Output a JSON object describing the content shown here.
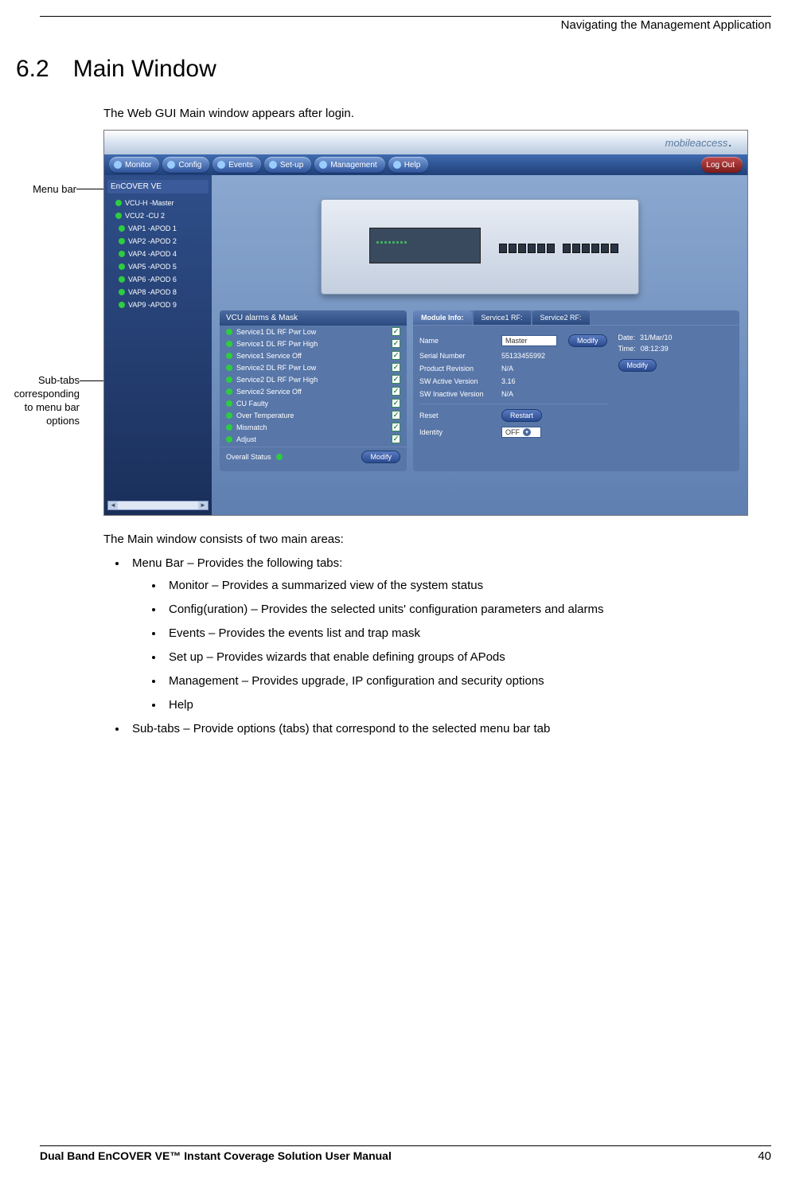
{
  "header": {
    "right": "Navigating the Management Application"
  },
  "section": {
    "number": "6.2",
    "title": "Main Window"
  },
  "intro": "The Web GUI Main window appears after login.",
  "callouts": {
    "menubar": "Menu bar",
    "subtabs": "Sub-tabs corresponding to menu bar options"
  },
  "screenshot": {
    "brand": "mobileaccess",
    "menu": {
      "items": [
        "Monitor",
        "Config",
        "Events",
        "Set-up",
        "Management",
        "Help"
      ],
      "logout": "Log Out"
    },
    "tree": {
      "title": "EnCOVER VE",
      "nodes": [
        {
          "label": "VCU-H -Master",
          "cls": "master"
        },
        {
          "label": "VCU2 -CU 2",
          "cls": "master"
        },
        {
          "label": "VAP1 -APOD 1"
        },
        {
          "label": "VAP2 -APOD 2"
        },
        {
          "label": "VAP4 -APOD 4"
        },
        {
          "label": "VAP5 -APOD 5"
        },
        {
          "label": "VAP6 -APOD 6"
        },
        {
          "label": "VAP8 -APOD 8"
        },
        {
          "label": "VAP9 -APOD 9"
        }
      ]
    },
    "alarms": {
      "title": "VCU alarms & Mask",
      "items": [
        "Service1 DL RF Pwr Low",
        "Service1 DL RF Pwr High",
        "Service1 Service Off",
        "Service2 DL RF Pwr Low",
        "Service2 DL RF Pwr High",
        "Service2 Service Off",
        "CU Faulty",
        "Over Temperature",
        "Mismatch",
        "Adjust"
      ],
      "overall_label": "Overall Status",
      "modify": "Modify"
    },
    "module": {
      "tabs": [
        "Module Info:",
        "Service1 RF:",
        "Service2 RF:"
      ],
      "fields": {
        "name_lbl": "Name",
        "name_val": "Master",
        "name_modify": "Modify",
        "sn_lbl": "Serial Number",
        "sn_val": "55133455992",
        "pr_lbl": "Product Revision",
        "pr_val": "N/A",
        "sav_lbl": "SW Active Version",
        "sav_val": "3.16",
        "siv_lbl": "SW Inactive Version",
        "siv_val": "N/A",
        "reset_lbl": "Reset",
        "reset_btn": "Restart",
        "id_lbl": "Identity",
        "id_val": "OFF"
      },
      "date": {
        "date_lbl": "Date:",
        "date_val": "31/Mar/10",
        "time_lbl": "Time:",
        "time_val": "08:12:39",
        "modify": "Modify"
      }
    }
  },
  "after": {
    "lead": "The Main window consists of two main areas:",
    "b1a": "Menu Bar – Provides the following tabs:",
    "b2": [
      "Monitor – Provides a summarized view of the system status",
      "Config(uration) – Provides the selected units' configuration parameters and alarms",
      "Events – Provides the events list and trap mask",
      "Set up – Provides wizards that enable defining groups of APods",
      "Management – Provides upgrade, IP configuration and security options",
      "Help"
    ],
    "b1b": "Sub-tabs – Provide options (tabs) that correspond to the selected menu bar tab"
  },
  "footer": {
    "title": "Dual Band EnCOVER VE™ Instant Coverage Solution User Manual",
    "page": "40"
  }
}
